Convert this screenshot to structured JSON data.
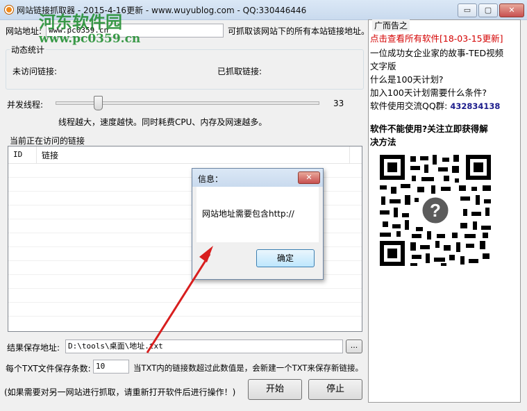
{
  "window": {
    "title": "网站链接抓取器 - 2015-4-16更新 - www.wuyublog.com - QQ:330446446",
    "min": "▭",
    "max": "▢",
    "close": "✕"
  },
  "watermark": {
    "line1": "河东软件园",
    "line2": "www.pc0359.cn"
  },
  "url": {
    "label": "网站地址:",
    "value": "www.pc0359.cn",
    "hint": "可抓取该网站下的所有本站链接地址。"
  },
  "stats": {
    "legend": "动态统计",
    "unvisited_label": "未访问链接:",
    "fetched_label": "已抓取链接:"
  },
  "threads": {
    "label": "并发线程:",
    "value": "33",
    "level": 0.16,
    "hint": "线程越大，速度越快。同时耗费CPU、内存及网速越多。"
  },
  "list": {
    "legend": "当前正在访问的链接",
    "columns": [
      "ID",
      "链接"
    ]
  },
  "save": {
    "label": "结果保存地址:",
    "value": "D:\\tools\\桌面\\地址.txt",
    "browse": "..."
  },
  "limit": {
    "label": "每个TXT文件保存条数:",
    "value": "10",
    "hint": "当TXT内的链接数超过此数值是，会新建一个TXT来保存新链接。"
  },
  "footer": {
    "note": "(如果需要对另一网站进行抓取，请重新打开软件后进行操作！)",
    "start": "开始",
    "stop": "停止"
  },
  "ad": {
    "title": "广而告之",
    "link1": "点击查看所有软件[18-03-15更新]",
    "line2": "一位成功女企业家的故事-TED视频",
    "line3": "文字版",
    "line4": "什么是100天计划?",
    "line5": "加入100天计划需要什么条件?",
    "qq_label": "软件使用交流QQ群:",
    "qq_value": "432834138",
    "bold1": "软件不能使用?关注立即获得解",
    "bold2": "决方法"
  },
  "dialog": {
    "title": "信息：",
    "message": "网站地址需要包含http://",
    "ok": "确定",
    "close": "✕"
  },
  "colors": {
    "ad_link": "#d40000",
    "qq_number": "#1c1c8c",
    "arrow": "#d81e1e",
    "watermark": "#1a8a2a"
  }
}
